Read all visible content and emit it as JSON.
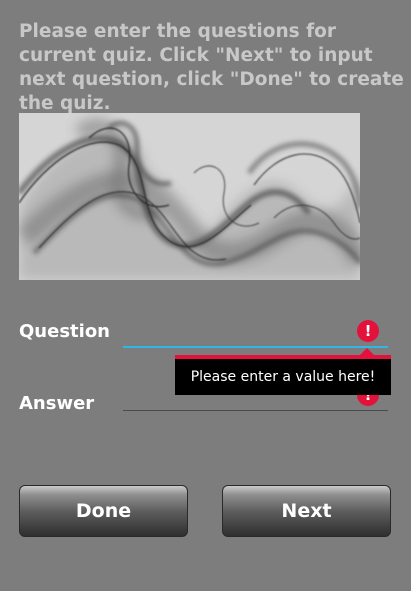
{
  "instructions": "Please enter the questions for current quiz. Click \"Next\" to input next question, click \"Done\" to create the quiz.",
  "form": {
    "question_label": "Question",
    "question_value": "",
    "answer_label": "Answer",
    "answer_value": "",
    "error_icon_glyph": "!",
    "error_message": "Please enter a value here!"
  },
  "buttons": {
    "done_label": "Done",
    "next_label": "Next"
  },
  "colors": {
    "background": "#7d7d7d",
    "focus_underline": "#33b5e5",
    "error_red": "#e3123c",
    "instruction_text": "#c8c8c8"
  },
  "icons": {
    "error": "error-icon",
    "banner": "smoke-image"
  }
}
